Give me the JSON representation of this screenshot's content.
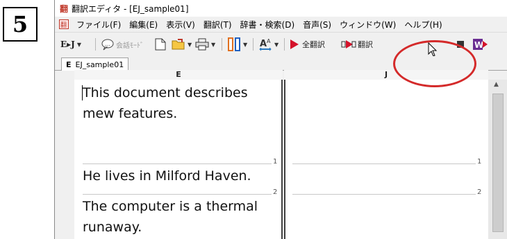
{
  "step": {
    "number": "5"
  },
  "window": {
    "title": "翻訳エディタ - [EJ_sample01]"
  },
  "menu": {
    "items": [
      "ファイル(F)",
      "編集(E)",
      "表示(V)",
      "翻訳(T)",
      "辞書・検索(D)",
      "音声(S)",
      "ウィンドウ(W)",
      "ヘルプ(H)"
    ]
  },
  "toolbar": {
    "direction_label": "E▸J",
    "conversation_mode_label": "会話ﾓｰﾄﾞ",
    "translate_all_label": "全翻訳",
    "translate_label": "翻訳",
    "translate_text_label": "W▸ 訳"
  },
  "tab": {
    "letter": "E",
    "label": "EJ_sample01"
  },
  "columns": {
    "left": "E",
    "right": "J"
  },
  "sentences": [
    {
      "text": "This document describes\nmew features.",
      "index": "1"
    },
    {
      "text": "He lives in Milford Haven.",
      "index": "2"
    },
    {
      "text": "The computer is a thermal\nrunaway.",
      "index": ""
    }
  ],
  "colors": {
    "highlight": "#d42a2a",
    "play_red": "#d4122a"
  }
}
